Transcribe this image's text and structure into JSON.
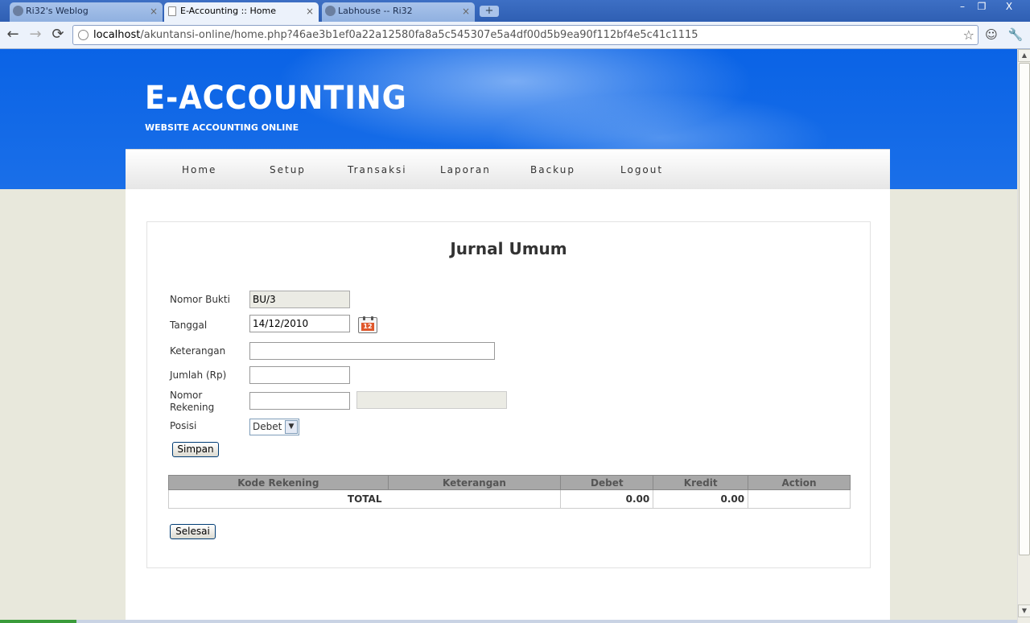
{
  "browser": {
    "tabs": [
      {
        "label": "Ri32's Weblog",
        "active": false
      },
      {
        "label": "E-Accounting :: Home",
        "active": true
      },
      {
        "label": "Labhouse -- Ri32",
        "active": false
      }
    ],
    "new_tab": "+",
    "window_controls": {
      "minimize": "–",
      "restore": "❐",
      "close": "X"
    },
    "address_host": "localhost",
    "address_path": "/akuntansi-online/home.php?46ae3b1ef0a22a12580fa8a5c545307e5a4df00d5b9ea90f112bf4e5c41c1115"
  },
  "site": {
    "title": "E-ACCOUNTING",
    "subtitle": "WEBSITE ACCOUNTING ONLINE"
  },
  "menu": [
    "Home",
    "Setup",
    "Transaksi",
    "Laporan",
    "Backup",
    "Logout"
  ],
  "form": {
    "title": "Jurnal Umum",
    "labels": {
      "nomor_bukti": "Nomor Bukti",
      "tanggal": "Tanggal",
      "keterangan": "Keterangan",
      "jumlah": "Jumlah (Rp)",
      "nomor_rekening_1": "Nomor",
      "nomor_rekening_2": "Rekening",
      "posisi": "Posisi"
    },
    "values": {
      "nomor_bukti": "BU/3",
      "tanggal": "14/12/2010",
      "keterangan": "",
      "jumlah": "",
      "nomor_rekening": "",
      "nama_rekening": "",
      "posisi": "Debet"
    },
    "calendar_day": "12",
    "simpan": "Simpan",
    "selesai": "Selesai"
  },
  "table": {
    "headers": [
      "Kode Rekening",
      "Keterangan",
      "Debet",
      "Kredit",
      "Action"
    ],
    "total_label": "TOTAL",
    "total_debet": "0.00",
    "total_kredit": "0.00"
  },
  "icons": {
    "back": "←",
    "forward": "→",
    "reload": "⟳",
    "star": "☆",
    "page_menu": "☺",
    "wrench": "🔧",
    "select_arrow": "▼",
    "scroll_up": "▲",
    "scroll_down": "▼"
  }
}
